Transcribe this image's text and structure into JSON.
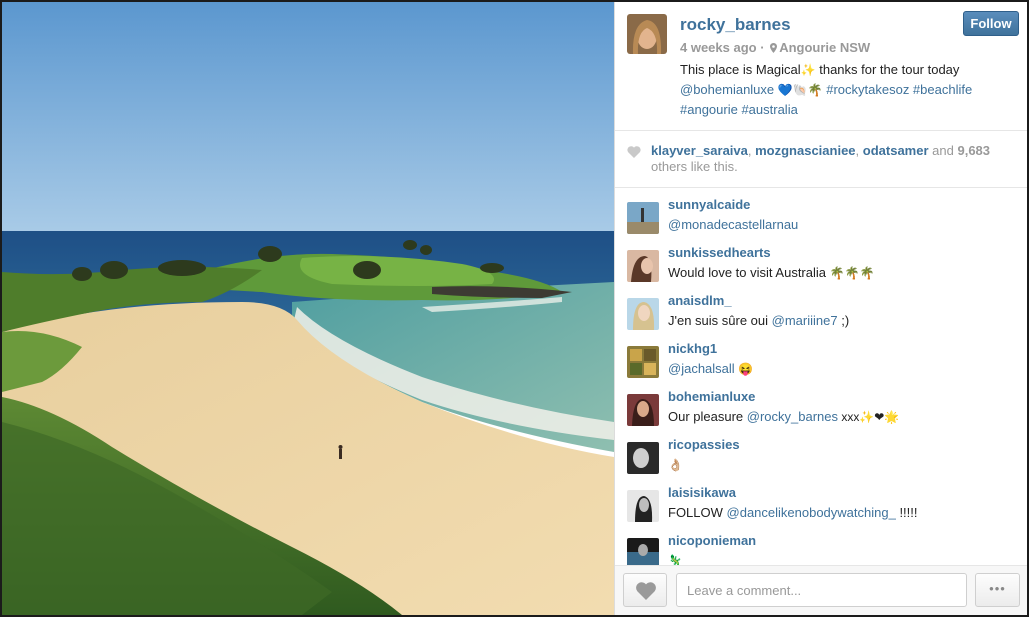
{
  "post": {
    "username": "rocky_barnes",
    "follow_label": "Follow",
    "time_ago": "4 weeks ago",
    "separator": "·",
    "location": "Angourie NSW",
    "caption_text": "This place is Magical",
    "caption_sparkle": "✨",
    "caption_text2": " thanks for the tour today ",
    "caption_mention": "@bohemianluxe",
    "caption_emojis": "💙🐚🌴",
    "caption_tags": "#rockytakesoz #beachlife #angourie #australia"
  },
  "likes": {
    "user1": "klayver_saraiva",
    "user2": "mozgnascianiee",
    "user3": "odatsamer",
    "and": "and",
    "count": "9,683",
    "suffix": "others like this."
  },
  "comments": [
    {
      "user": "sunnyalcaide",
      "pre": "",
      "mention": "@monadecastellarnau",
      "post": ""
    },
    {
      "user": "sunkissedhearts",
      "pre": "Would love to visit Australia ",
      "mention": "",
      "post": "🌴🌴🌴"
    },
    {
      "user": "anaisdlm_",
      "pre": "J'en suis sûre oui ",
      "mention": "@mariiine7",
      "post": " ;)"
    },
    {
      "user": "nickhg1",
      "pre": "",
      "mention": "@jachalsall",
      "post": " 😝"
    },
    {
      "user": "bohemianluxe",
      "pre": "Our pleasure ",
      "mention": "@rocky_barnes",
      "post": " xxx✨❤🌟"
    },
    {
      "user": "ricopassies",
      "pre": "👌🏼",
      "mention": "",
      "post": ""
    },
    {
      "user": "laisisikawa",
      "pre": "FOLLOW ",
      "mention": "@dancelikenobodywatching_",
      "post": " !!!!!"
    },
    {
      "user": "nicoponieman",
      "pre": "🦎",
      "mention": "",
      "post": ""
    }
  ],
  "footer": {
    "comment_placeholder": "Leave a comment...",
    "more_label": "•••"
  },
  "icons": {
    "location": "location-pin-icon",
    "like": "heart-icon",
    "more": "ellipsis-icon"
  },
  "colors": {
    "link": "#3f729b",
    "muted": "#999999",
    "follow_bg": "#3f729b"
  }
}
